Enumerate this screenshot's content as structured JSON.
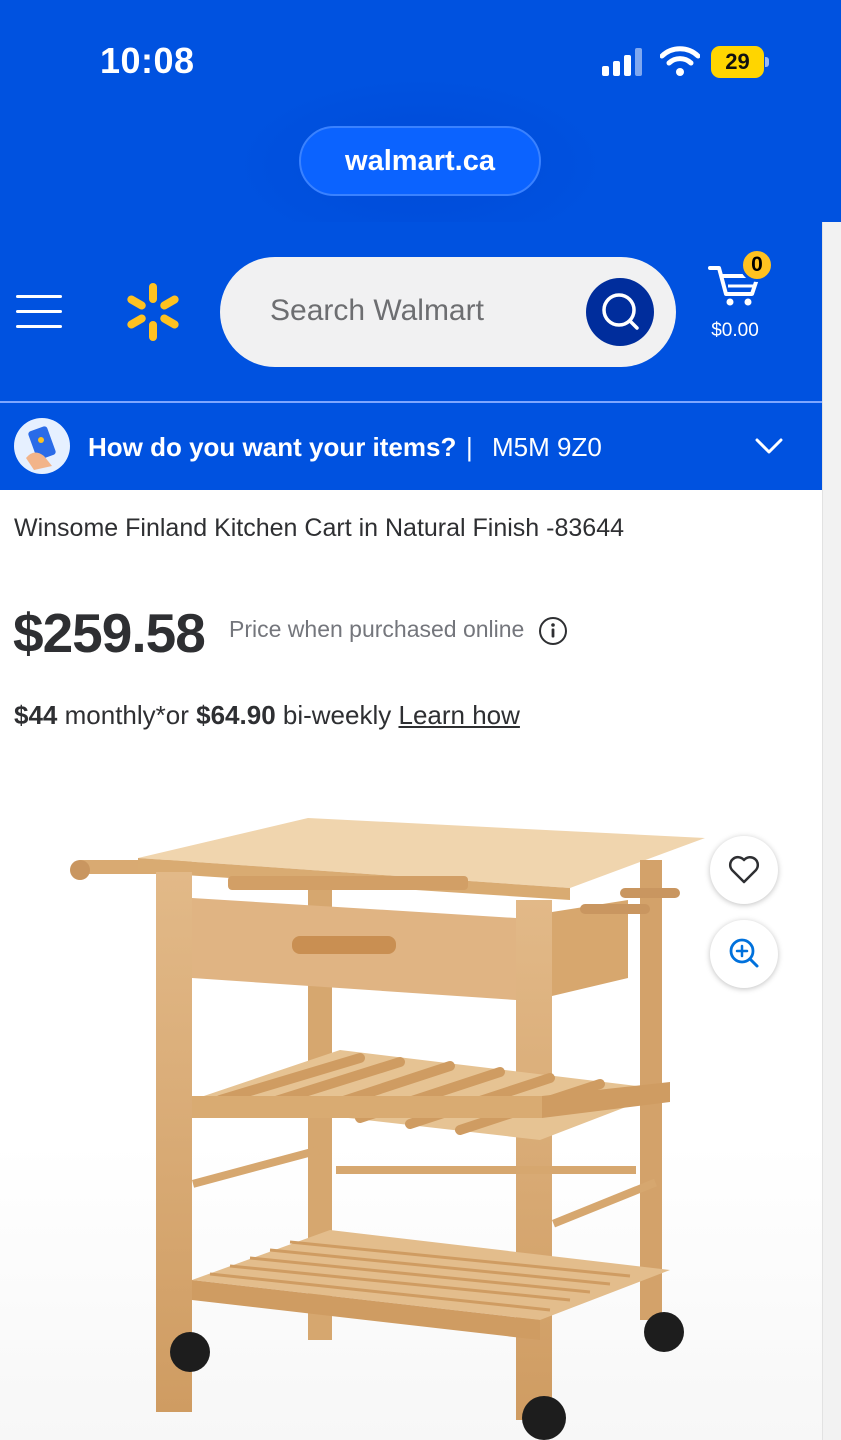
{
  "status_bar": {
    "time": "10:08",
    "battery": "29"
  },
  "browser": {
    "url": "walmart.ca"
  },
  "header": {
    "search_placeholder": "Search Walmart",
    "cart_count": "0",
    "cart_total": "$0.00"
  },
  "fulfillment": {
    "question": "How do you want your items?",
    "separator": "|",
    "postal_code": "M5M 9Z0"
  },
  "product": {
    "title": "Winsome Finland Kitchen Cart in Natural Finish -83644",
    "price": "$259.58",
    "price_note": "Price when purchased online",
    "financing": {
      "monthly_amount": "$44",
      "monthly_text": " monthly*or ",
      "biweekly_amount": "$64.90",
      "biweekly_text": " bi-weekly ",
      "learn_link": "Learn how"
    }
  },
  "colors": {
    "brand_blue": "#0052e0",
    "spark_yellow": "#ffc220",
    "search_button": "#002d9c"
  },
  "icons": [
    "menu-icon",
    "walmart-spark-logo",
    "search-icon",
    "cart-icon",
    "chevron-down-icon",
    "info-icon",
    "heart-icon",
    "zoom-in-icon"
  ]
}
